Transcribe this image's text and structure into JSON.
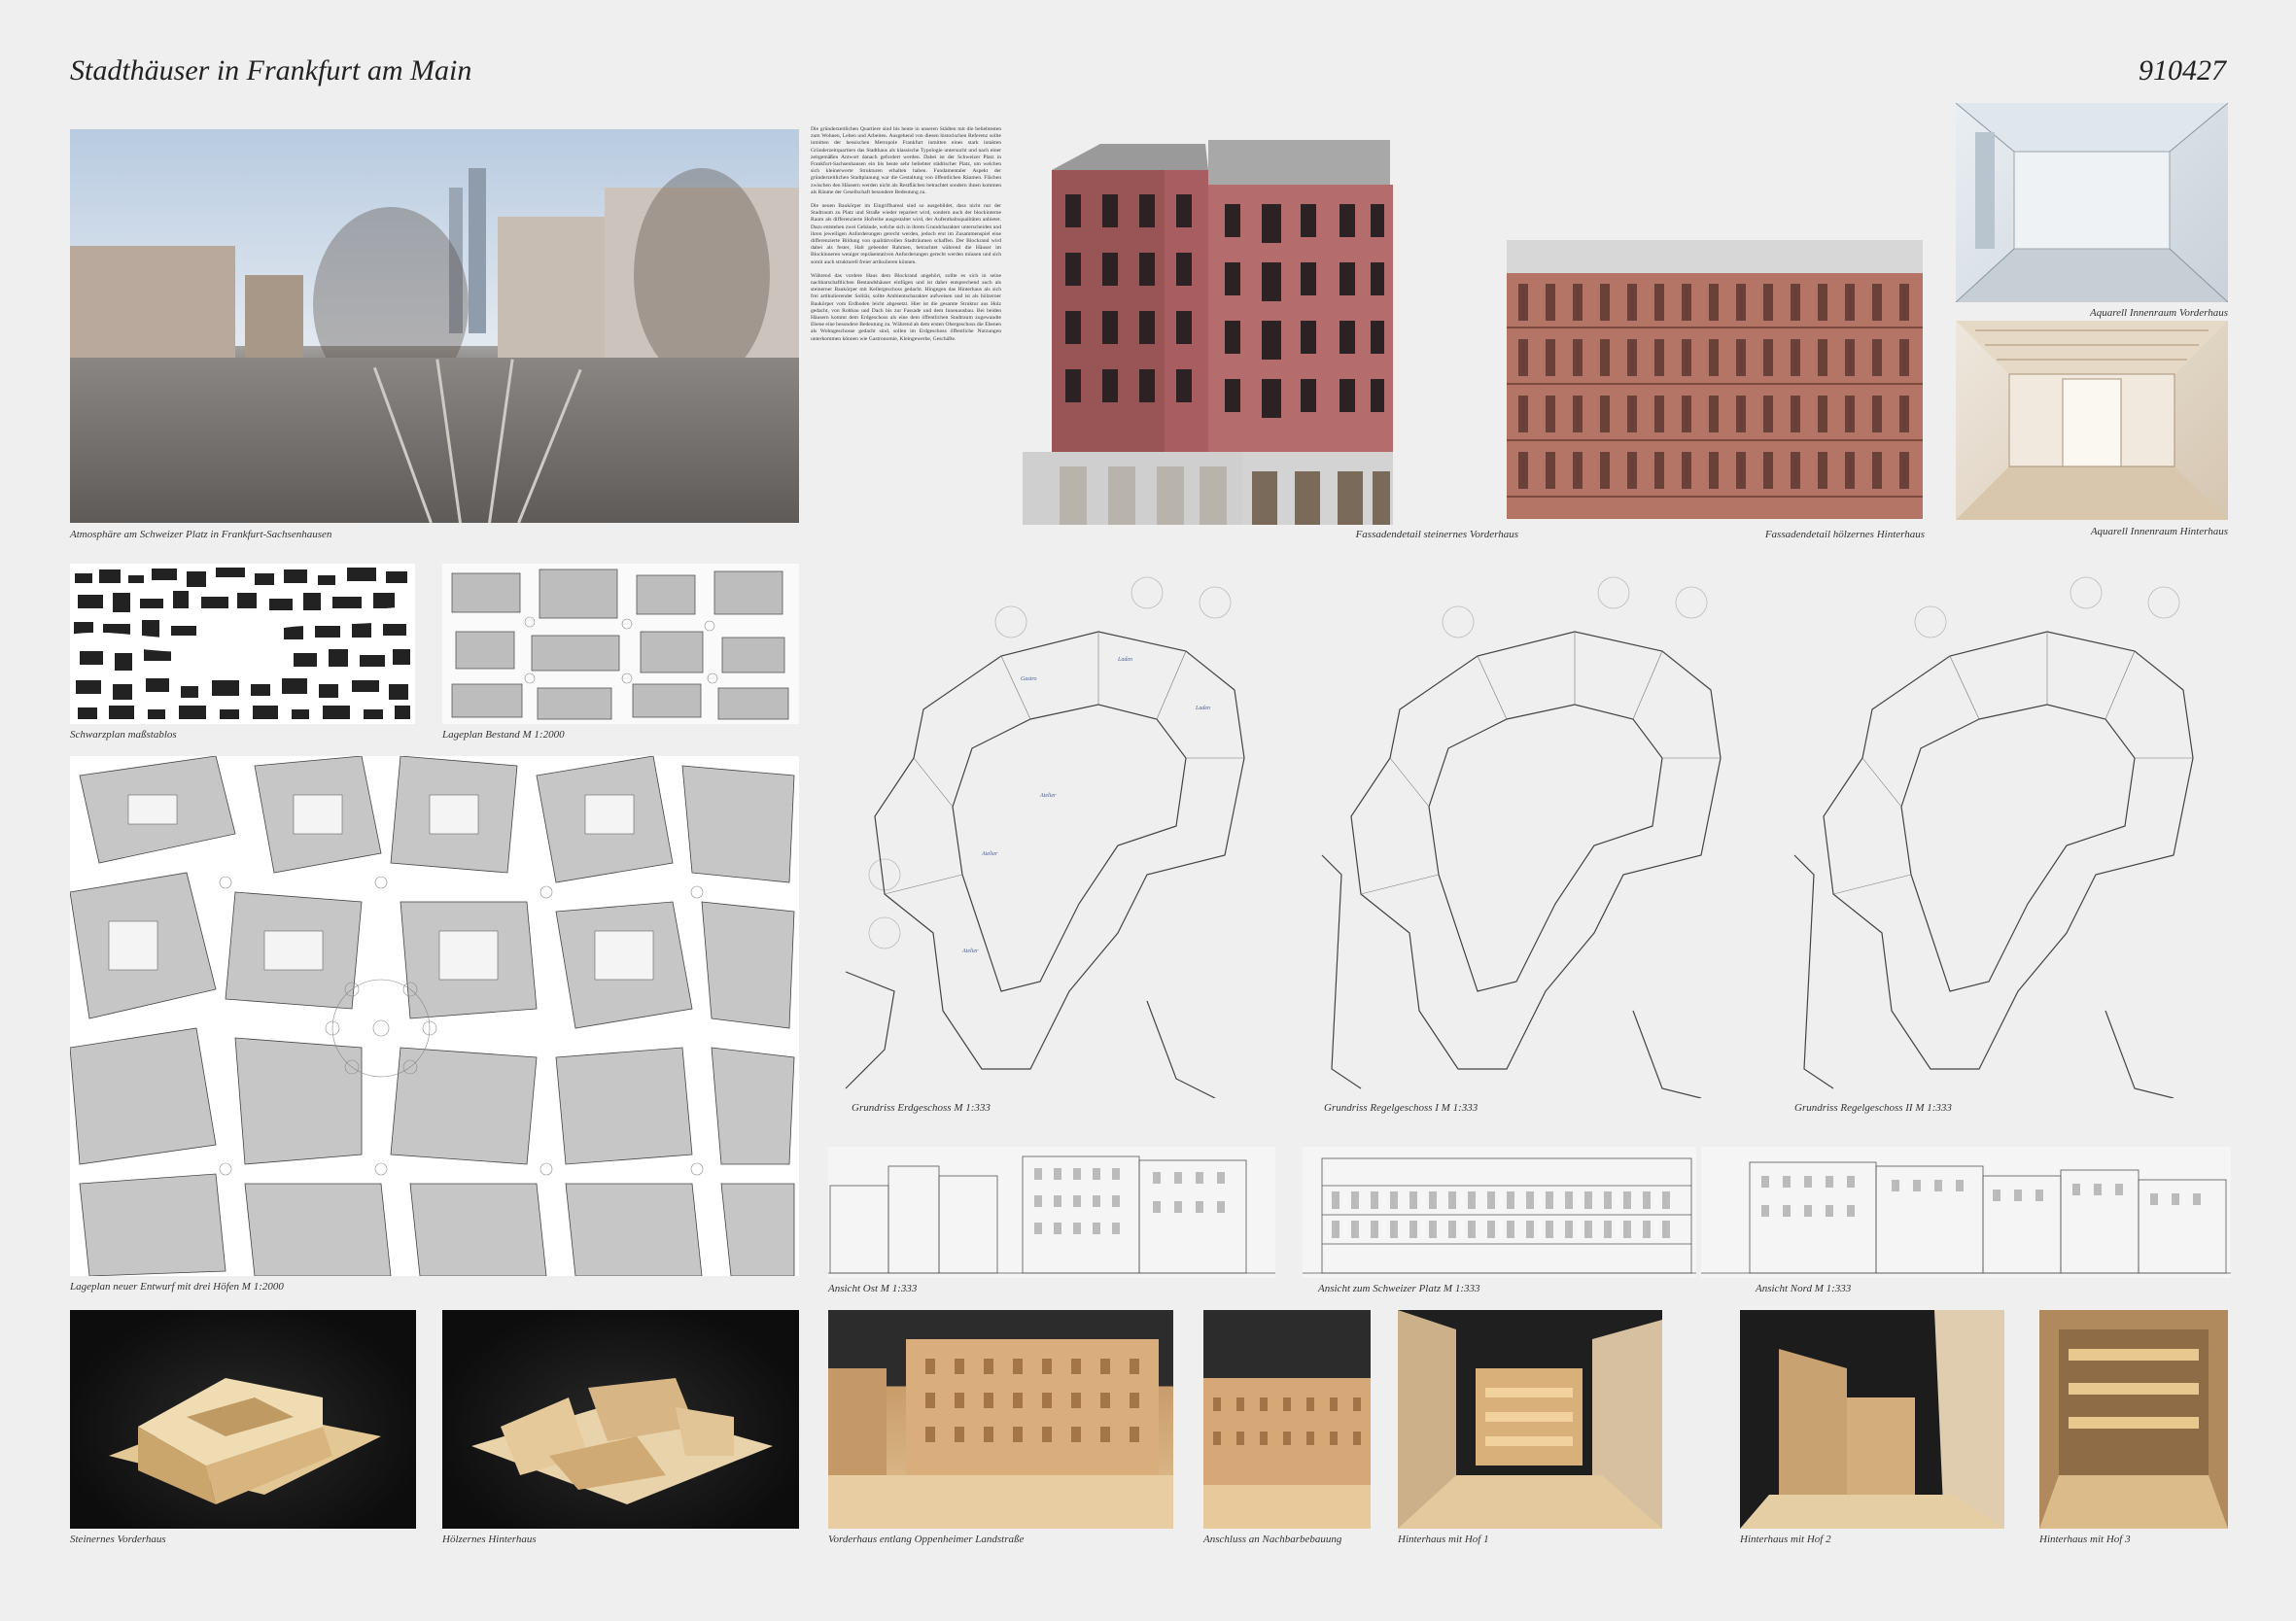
{
  "header": {
    "title": "Stadthäuser in Frankfurt am Main",
    "code": "910427"
  },
  "text_block": {
    "paragraphs": [
      "Die gründerzeitlichen Quartiere sind bis heute in unseren Städten mit die beliebtesten zum Wohnen, Leben und Arbeiten. Ausgehend von diesen historischen Referenz sollte inmitten der hessischen Metropole Frankfurt inmitten eines stark intakten Gründerzeitquartiers das Stadthaus als klassische Typologie untersucht und nach einer zeitgemäßen Antwort danach gefordert werden. Dabei ist der Schweizer Platz in Frankfurt-Sachsenhausen ein bis heute sehr beliebter städtischer Platz, um welchen sich kleinerwerte Strukturen erhalten haben. Fundamentaler Aspekt der gründerzeitlichen Stadtplanung war die Gestaltung von öffentlichen Räumen. Flächen zwischen den Häusern werden nicht als Restflächen betrachtet sondern ihnen kommen als Räume der Gesellschaft besondere Bedeutung zu.",
      "Die neuen Baukörper im Eingriffsareal sind so ausgebildet, dass nicht nur der Stadtraum zu Platz und Straße wieder repariert wird, sondern auch der blockinterne Raum als differenzierte Hofreihe ausgestaltet wird, der Aufenthaltsqualitäten anbietet. Dazu entstehen zwei Gebäude, welche sich in ihrem Grundcharakter unterscheiden und ihren jeweiligen Anforderungen gerecht werden, jedoch erst im Zusammenspiel eine differenzierte Bildung von qualitätvollen Stadträumen schaffen. Der Blockrand wird dabei als fester, Halt gebender Rahmen, betrachtet während die Häuser im Blockinneren weniger repräsentativen Anforderungen gerecht werden müssen und sich somit auch strukturell freier artikulieren können.",
      "Während das vordere Haus dem Blockrand angehört, sollte es sich in seine nachbarschaftlichen Bestandshäuser einfügen und ist daher entsprechend auch als steinerner Baukörper mit Kellergeschoss gedacht. Hingegen das Hinterhaus als sich frei artikulierender Solitär, sollte Ambientscharakter aufweisen und ist als hölzerner Baukörper vom Erdboden leicht abgesetzt. Hier ist die gesamte Struktur aus Holz gedacht, von Rohbau und Dach bis zur Fassade und dem Innenausbau. Bei beiden Häusern kommt dem Erdgeschoss als eine dem öffentlichen Stadtraum zugewandte Ebene eine besondere Bedeutung zu. Während ab dem ersten Obergeschoss die Ebenen als Wohngeschosse gedacht sind, sollen im Erdgeschoss öffentliche Nutzungen unterkommen können wie Gastronomie, Kleingewerbe, Geschäfte."
    ]
  },
  "captions": {
    "street_photo": "Atmosphäre am Schweizer Platz in Frankfurt-Sachsenhausen",
    "facade_stone": "Fassadendetail steinernes Vorderhaus",
    "facade_wood": "Fassadendetail hölzernes Hinterhaus",
    "aqua_front": "Aquarell Innenraum Vorderhaus",
    "aqua_rear": "Aquarell Innenraum Hinterhaus",
    "schwarzplan": "Schwarzplan maßstablos",
    "lageplan_bestand": "Lageplan Bestand  M 1:2000",
    "lageplan_neu": "Lageplan neuer Entwurf mit drei Höfen  M 1:2000",
    "grundriss_eg": "Grundriss Erdgeschoss  M 1:333",
    "grundriss_rg1": "Grundriss Regelgeschoss I  M 1:333",
    "grundriss_rg2": "Grundriss Regelgeschoss II  M 1:333",
    "ansicht_ost": "Ansicht Ost  M 1:333",
    "ansicht_platz": "Ansicht zum Schweizer Platz  M 1:333",
    "ansicht_nord": "Ansicht Nord  M 1:333",
    "model_stone": "Steinernes Vorderhaus",
    "model_wood": "Hölzernes Hinterhaus",
    "model_street": "Vorderhaus entlang Oppenheimer Landstraße",
    "model_neighbor": "Anschluss an Nachbarbebauung",
    "model_yard1": "Hinterhaus mit Hof 1",
    "model_yard2": "Hinterhaus mit Hof 2",
    "model_yard3": "Hinterhaus mit Hof 3"
  }
}
